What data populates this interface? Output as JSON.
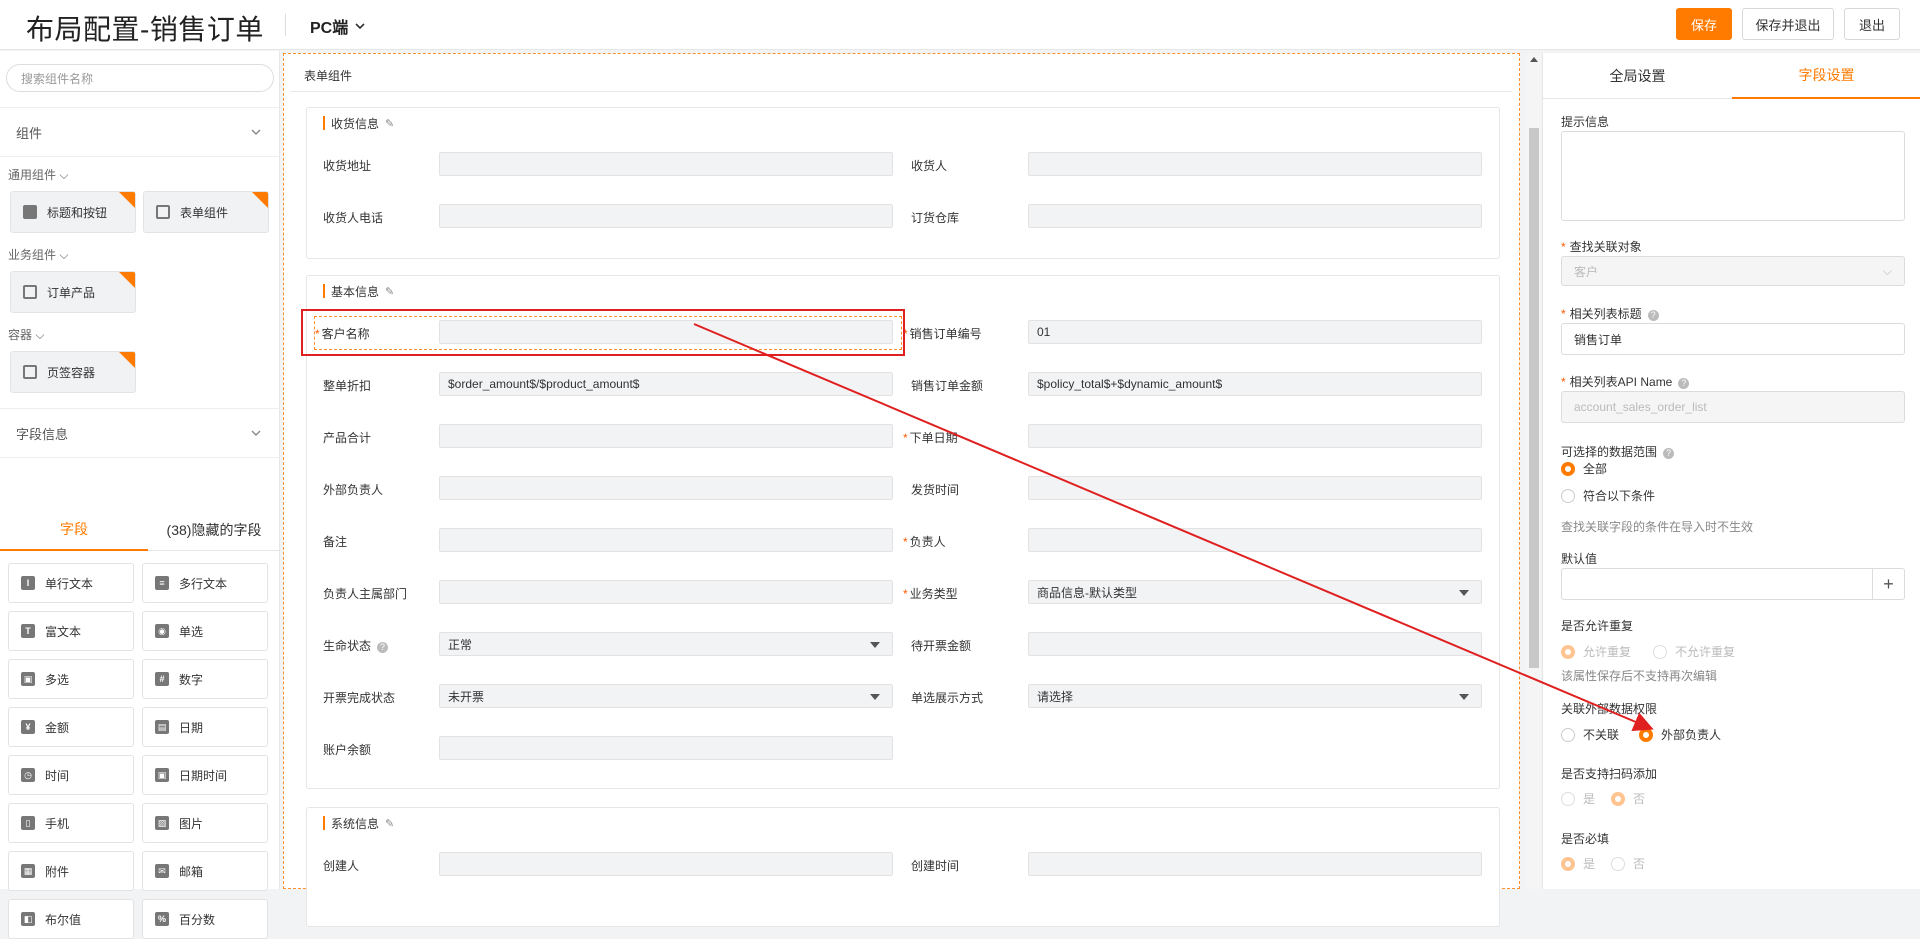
{
  "header": {
    "title": "布局配置-销售订单",
    "platform": "PC端",
    "save": "保存",
    "save_exit": "保存并退出",
    "exit": "退出"
  },
  "left": {
    "search_placeholder": "搜索组件名称",
    "components_section": "组件",
    "common_group": "通用组件",
    "common_items": [
      "标题和按钮",
      "表单组件"
    ],
    "business_group": "业务组件",
    "business_items": [
      "订单产品"
    ],
    "container_group": "容器",
    "container_items": [
      "页签容器"
    ],
    "field_section": "字段信息",
    "tabs": [
      "字段",
      "(38)隐藏的字段"
    ],
    "fields": [
      "单行文本",
      "多行文本",
      "富文本",
      "单选",
      "多选",
      "数字",
      "金额",
      "日期",
      "时间",
      "日期时间",
      "手机",
      "图片",
      "附件",
      "邮箱",
      "布尔值",
      "百分数"
    ]
  },
  "canvas": {
    "head": "表单组件",
    "groups": [
      {
        "title": "收货信息",
        "fields": [
          {
            "label": "收货地址",
            "value": "",
            "req": false
          },
          {
            "label": "收货人",
            "value": "",
            "req": false
          },
          {
            "label": "收货人电话",
            "value": "",
            "req": false
          },
          {
            "label": "订货仓库",
            "value": "",
            "req": false
          }
        ]
      },
      {
        "title": "基本信息",
        "fields": [
          {
            "label": "客户名称",
            "value": "",
            "req": true
          },
          {
            "label": "销售订单编号",
            "value": "01",
            "req": true
          },
          {
            "label": "整单折扣",
            "value": "$order_amount$/$product_amount$",
            "req": false
          },
          {
            "label": "销售订单金额",
            "value": "$policy_total$+$dynamic_amount$",
            "req": false
          },
          {
            "label": "产品合计",
            "value": "",
            "req": false
          },
          {
            "label": "下单日期",
            "value": "",
            "req": true
          },
          {
            "label": "外部负责人",
            "value": "",
            "req": false
          },
          {
            "label": "发货时间",
            "value": "",
            "req": false
          },
          {
            "label": "备注",
            "value": "",
            "req": false
          },
          {
            "label": "负责人",
            "value": "",
            "req": true
          },
          {
            "label": "负责人主属部门",
            "value": "",
            "req": false
          },
          {
            "label": "业务类型",
            "value": "商品信息-默认类型",
            "req": true,
            "select": true
          },
          {
            "label": "生命状态",
            "value": "正常",
            "req": false,
            "select": true,
            "help": true
          },
          {
            "label": "待开票金额",
            "value": "",
            "req": false
          },
          {
            "label": "开票完成状态",
            "value": "未开票",
            "req": false,
            "select": true
          },
          {
            "label": "单选展示方式",
            "value": "请选择",
            "req": false,
            "select": true
          },
          {
            "label": "账户余额",
            "value": "",
            "req": false
          }
        ]
      },
      {
        "title": "系统信息",
        "fields": [
          {
            "label": "创建人",
            "value": "",
            "req": false
          },
          {
            "label": "创建时间",
            "value": "",
            "req": false
          }
        ]
      }
    ]
  },
  "right": {
    "tabs": [
      "全局设置",
      "字段设置"
    ],
    "hint_label": "提示信息",
    "lookup_label": "查找关联对象",
    "lookup_value": "客户",
    "list_title_label": "相关列表标题",
    "list_title_value": "销售订单",
    "api_label": "相关列表API Name",
    "api_value": "account_sales_order_list",
    "range_label": "可选择的数据范围",
    "range_all": "全部",
    "range_cond": "符合以下条件",
    "range_hint": "查找关联字段的条件在导入时不生效",
    "default_label": "默认值",
    "dup_label": "是否允许重复",
    "dup_yes": "允许重复",
    "dup_no": "不允许重复",
    "dup_hint": "该属性保存后不支持再次编辑",
    "perm_label": "关联外部数据权限",
    "perm_none": "不关联",
    "perm_owner": "外部负责人",
    "scan_label": "是否支持扫码添加",
    "yes": "是",
    "no": "否",
    "required_label": "是否必填"
  },
  "colors": {
    "accent": "#ff7b00",
    "annotation": "#e02020"
  }
}
